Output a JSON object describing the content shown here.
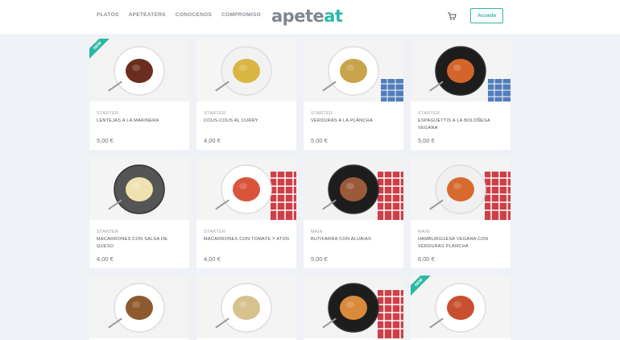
{
  "header": {
    "nav": [
      "PLATOS",
      "APETEATERS",
      "CONOCENOS",
      "COMPROMISO"
    ],
    "logo_part1": "apete",
    "logo_part2": "at",
    "cart_icon": "cart-icon",
    "login_label": "Accede",
    "accent": "#2bb8a6"
  },
  "badge_label": "NEW",
  "products": [
    {
      "category": "STARTER",
      "name": "LENTEJAS A LA MARINERA",
      "price": "5,00 €",
      "badge": true,
      "dish": "lentils",
      "plate": "#ffffff",
      "bg": "#f3f3f3"
    },
    {
      "category": "STARTER",
      "name": "COUS-COUS AL CURRY",
      "price": "4,00 €",
      "badge": false,
      "dish": "couscous",
      "plate": "#f2f2f2",
      "bg": "#f5f5f5"
    },
    {
      "category": "STARTER",
      "name": "VERDURAS A LA PLANCHA",
      "price": "5,00 €",
      "badge": false,
      "dish": "veggies",
      "plate": "#ffffff",
      "bg": "#f4f4f4"
    },
    {
      "category": "STARTER",
      "name": "ESPAGUETTIS A LA BOLOÑESA VEGANA",
      "price": "5,00 €",
      "badge": false,
      "dish": "spaghetti",
      "plate": "#1d1d1d",
      "bg": "#f3f3f3"
    },
    {
      "category": "STARTER",
      "name": "MACARRONES CON SALSA DE QUESO",
      "price": "4,00 €",
      "badge": false,
      "dish": "penne-cheese",
      "plate": "#555555",
      "bg": "#f4f4f4"
    },
    {
      "category": "STARTER",
      "name": "MACARRONES CON TOMATE Y ATÚN",
      "price": "4,00 €",
      "badge": false,
      "dish": "penne-tomato",
      "plate": "#ffffff",
      "bg": "#f4f4f4"
    },
    {
      "category": "MAIN",
      "name": "BUTIFARRA CON ALUBIAS",
      "price": "5,00 €",
      "badge": false,
      "dish": "sausage",
      "plate": "#1d1d1d",
      "bg": "#f2f2f2"
    },
    {
      "category": "MAIN",
      "name": "HAMBURGUESA VEGANA CON VERDURAS PLANCHA",
      "price": "6,00 €",
      "badge": false,
      "dish": "burger",
      "plate": "#f0f0f0",
      "bg": "#f4f4f4"
    },
    {
      "category": "",
      "name": "",
      "price": "",
      "badge": false,
      "dish": "rice",
      "plate": "#ffffff",
      "bg": "#f3f3f3"
    },
    {
      "category": "",
      "name": "",
      "price": "",
      "badge": false,
      "dish": "risotto",
      "plate": "#ffffff",
      "bg": "#f4f4f4"
    },
    {
      "category": "",
      "name": "",
      "price": "",
      "badge": false,
      "dish": "lasagna",
      "plate": "#1d1d1d",
      "bg": "#f3f3f3"
    },
    {
      "category": "",
      "name": "",
      "price": "",
      "badge": true,
      "dish": "fish",
      "plate": "#ffffff",
      "bg": "#f4f4f4"
    }
  ]
}
